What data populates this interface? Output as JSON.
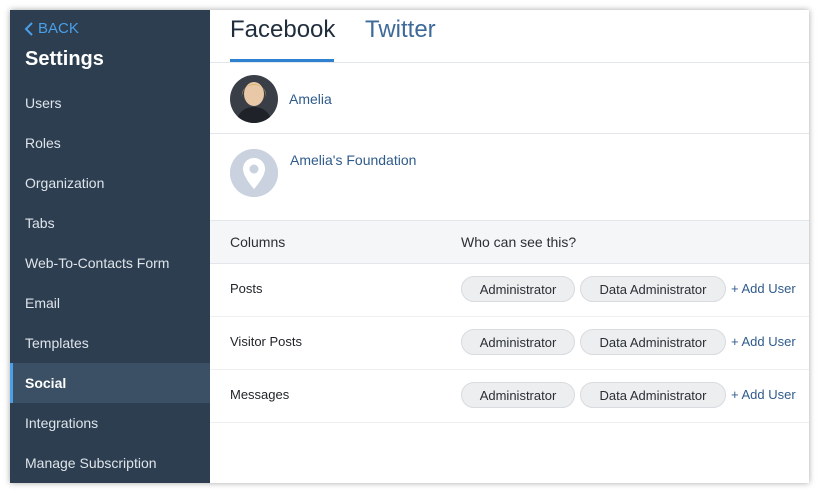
{
  "sidebar": {
    "back_label": "BACK",
    "title": "Settings",
    "items": [
      {
        "label": "Users"
      },
      {
        "label": "Roles"
      },
      {
        "label": "Organization"
      },
      {
        "label": "Tabs"
      },
      {
        "label": "Web-To-Contacts Form"
      },
      {
        "label": "Email"
      },
      {
        "label": "Templates"
      },
      {
        "label": "Social",
        "active": true
      },
      {
        "label": "Integrations"
      },
      {
        "label": "Manage Subscription"
      }
    ]
  },
  "tabs": [
    {
      "label": "Facebook",
      "active": true
    },
    {
      "label": "Twitter"
    }
  ],
  "profiles": [
    {
      "name": "Amelia",
      "icon": "user-avatar"
    },
    {
      "name": "Amelia's Foundation",
      "icon": "location-pin-icon"
    }
  ],
  "table": {
    "headers": {
      "columns": "Columns",
      "who": "Who can see this?"
    },
    "rows": [
      {
        "label": "Posts",
        "roles": [
          "Administrator",
          "Data Administrator"
        ],
        "add": "+ Add User"
      },
      {
        "label": "Visitor Posts",
        "roles": [
          "Administrator",
          "Data Administrator"
        ],
        "add": "+ Add User"
      },
      {
        "label": "Messages",
        "roles": [
          "Administrator",
          "Data Administrator"
        ],
        "add": "+ Add User"
      }
    ]
  },
  "colors": {
    "sidebar_bg": "#2c3e50",
    "accent": "#2f82cf",
    "link": "#2f5b8c"
  }
}
